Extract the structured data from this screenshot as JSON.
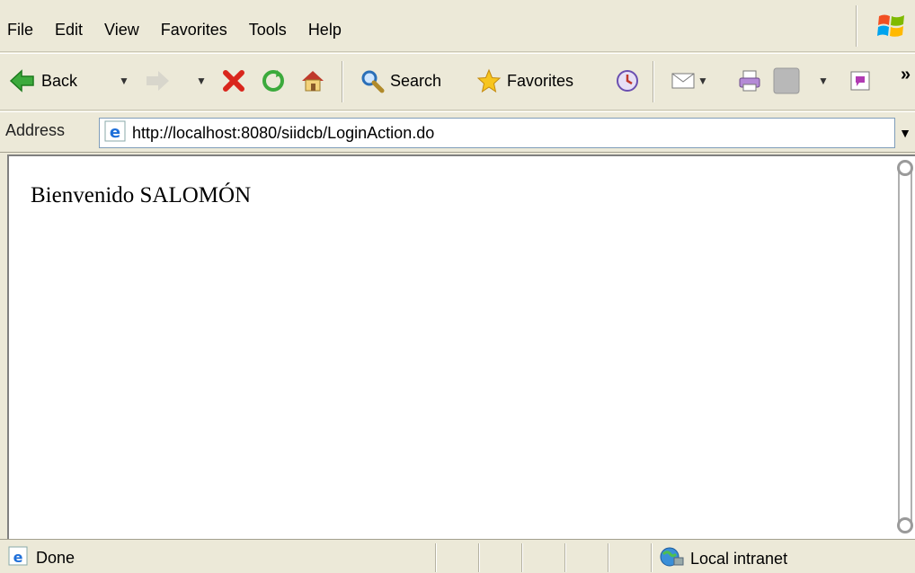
{
  "menubar": {
    "items": [
      "File",
      "Edit",
      "View",
      "Favorites",
      "Tools",
      "Help"
    ]
  },
  "toolbar": {
    "back_label": "Back",
    "search_label": "Search",
    "favorites_label": "Favorites",
    "more_chevron": "»"
  },
  "address": {
    "label": "Address",
    "url": "http://localhost:8080/siidcb/LoginAction.do"
  },
  "content": {
    "welcome_text": "Bienvenido SALOMÓN"
  },
  "status": {
    "text": "Done",
    "zone": "Local intranet"
  },
  "colors": {
    "chrome": "#ece9d8",
    "ie_blue": "#1e6fd9",
    "stop_red": "#d9261c",
    "back_green": "#3caa3c"
  }
}
